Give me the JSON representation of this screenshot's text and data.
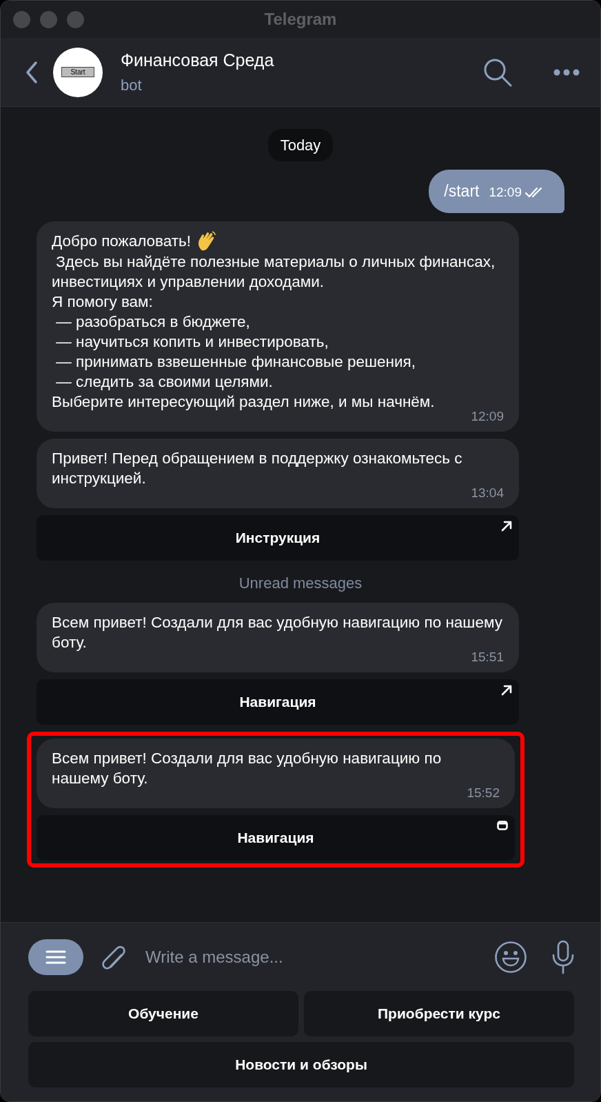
{
  "window": {
    "title": "Telegram"
  },
  "chat": {
    "name": "Финансовая Среда",
    "subtitle": "bot",
    "avatar_label": "Start"
  },
  "date_pill": "Today",
  "messages": [
    {
      "kind": "outgoing",
      "text": "/start",
      "time": "12:09",
      "read": true
    },
    {
      "kind": "incoming",
      "greeting": "Добро пожаловать!",
      "text": " Здесь вы найдёте полезные материалы о личных финансах, инвестициях и управлении доходами.\nЯ помогу вам:\n — разобраться в бюджете,\n — научиться копить и инвестировать,\n — принимать взвешенные финансовые решения,\n — следить за своими целями.\nВыберите интересующий раздел ниже, и мы начнём.",
      "time": "12:09"
    },
    {
      "kind": "incoming",
      "text": "Привет! Перед обращением в поддержку ознакомьтесь с инструкцией.",
      "time": "13:04",
      "button": {
        "label": "Инструкция",
        "kind": "link"
      }
    },
    {
      "kind": "divider",
      "text": "Unread messages"
    },
    {
      "kind": "incoming",
      "text": "Всем привет! Создали для вас удобную навигацию по нашему боту.",
      "time": "15:51",
      "button": {
        "label": "Навигация",
        "kind": "link"
      }
    },
    {
      "kind": "incoming",
      "text": "Всем привет! Создали для вас удобную навигацию по нашему боту.",
      "time": "15:52",
      "highlighted": true,
      "button": {
        "label": "Навигация",
        "kind": "webapp"
      }
    }
  ],
  "composer": {
    "placeholder": "Write a message..."
  },
  "keyboard": [
    [
      "Обучение",
      "Приобрести курс"
    ],
    [
      "Новости и обзоры"
    ]
  ]
}
